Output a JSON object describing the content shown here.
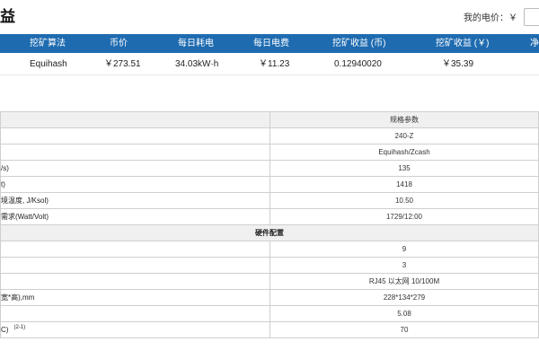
{
  "header": {
    "title": "益",
    "price_label": "我的电价：￥",
    "price_value": ""
  },
  "profit_table": {
    "columns": [
      "挖矿算法",
      "币价",
      "每日耗电",
      "每日电费",
      "挖矿收益 (币)",
      "挖矿收益 (￥)",
      "净"
    ],
    "row": [
      "Equihash",
      "￥273.51",
      "34.03kW·h",
      "￥11.23",
      "0.12940020",
      "￥35.39"
    ]
  },
  "spec_table": {
    "header_value": "规格参数",
    "rows": [
      {
        "label": "",
        "value": "240-Z"
      },
      {
        "label": "",
        "value": "Equihash/Zcash"
      },
      {
        "label": "/s)",
        "value": "135"
      },
      {
        "label": "t)",
        "value": "1418"
      },
      {
        "label": "境温度, J/Ksol)",
        "value": "10.50"
      },
      {
        "label": "需求(Watt/Volt)",
        "value": "1729/12:00"
      }
    ],
    "section_title": "硬件配置",
    "hw_rows": [
      {
        "label": "",
        "value": "9"
      },
      {
        "label": "",
        "value": "3"
      },
      {
        "label": "",
        "value": "RJ45 以太网 10/100M"
      },
      {
        "label": "宽*高),mm",
        "value": "228*134*279"
      },
      {
        "label": "",
        "value": "5.08"
      },
      {
        "label": "C)",
        "sup": "(2-1)",
        "value": "70"
      }
    ]
  }
}
